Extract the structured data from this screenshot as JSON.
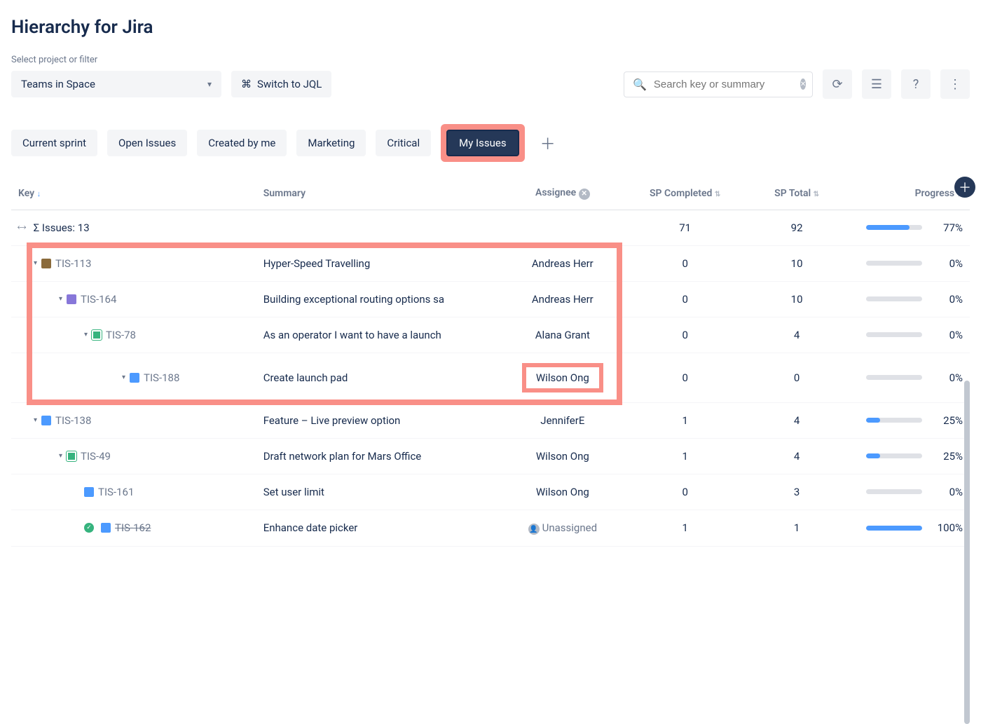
{
  "page_title": "Hierarchy for Jira",
  "project_selector": {
    "label": "Select project or filter",
    "value": "Teams in Space"
  },
  "jql_button": "Switch to JQL",
  "search": {
    "placeholder": "Search key or summary"
  },
  "filters": [
    {
      "label": "Current sprint",
      "active": false
    },
    {
      "label": "Open Issues",
      "active": false
    },
    {
      "label": "Created by me",
      "active": false
    },
    {
      "label": "Marketing",
      "active": false
    },
    {
      "label": "Critical",
      "active": false
    },
    {
      "label": "My Issues",
      "active": true,
      "highlighted": true
    }
  ],
  "columns": {
    "key": "Key",
    "summary": "Summary",
    "assignee": "Assignee",
    "sp_completed": "SP Completed",
    "sp_total": "SP Total",
    "progress": "Progress"
  },
  "totals": {
    "label": "Σ Issues: 13",
    "sp_completed": 71,
    "sp_total": 92,
    "progress_pct": 77
  },
  "rows": [
    {
      "key": "TIS-113",
      "indent": 1,
      "icon": "epic-brown",
      "summary": "Hyper-Speed Travelling",
      "assignee": "Andreas Herr",
      "sp_completed": 0,
      "sp_total": 10,
      "progress_pct": 0,
      "highlight_group": true
    },
    {
      "key": "TIS-164",
      "indent": 2,
      "icon": "epic-purple",
      "summary": "Building exceptional routing options sa",
      "assignee": "Andreas Herr",
      "sp_completed": 0,
      "sp_total": 10,
      "progress_pct": 0,
      "highlight_group": true
    },
    {
      "key": "TIS-78",
      "indent": 3,
      "icon": "story-green",
      "summary": "As an operator I want to have a launch",
      "assignee": "Alana Grant",
      "sp_completed": 0,
      "sp_total": 4,
      "progress_pct": 0,
      "highlight_group": true
    },
    {
      "key": "TIS-188",
      "indent": 4,
      "icon": "task-blue",
      "summary": "Create launch pad",
      "assignee": "Wilson Ong",
      "sp_completed": 0,
      "sp_total": 0,
      "progress_pct": 0,
      "highlight_group": true,
      "highlight_assignee": true
    },
    {
      "key": "TIS-138",
      "indent": 1,
      "icon": "task-blue",
      "summary": "Feature – Live preview option",
      "assignee": "JenniferE",
      "sp_completed": 1,
      "sp_total": 4,
      "progress_pct": 25
    },
    {
      "key": "TIS-49",
      "indent": 2,
      "icon": "story-green",
      "summary": "Draft network plan for Mars Office",
      "assignee": "Wilson Ong",
      "sp_completed": 1,
      "sp_total": 4,
      "progress_pct": 25
    },
    {
      "key": "TIS-161",
      "indent": 3,
      "icon": "task-blue",
      "summary": "Set user limit",
      "assignee": "Wilson Ong",
      "sp_completed": 0,
      "sp_total": 3,
      "progress_pct": 0,
      "no_chevron": true
    },
    {
      "key": "TIS-162",
      "indent": 3,
      "icon": "done-blue",
      "summary": "Enhance date picker",
      "assignee": "Unassigned",
      "sp_completed": 1,
      "sp_total": 1,
      "progress_pct": 100,
      "no_chevron": true,
      "strike": true,
      "assignee_muted": true
    }
  ]
}
